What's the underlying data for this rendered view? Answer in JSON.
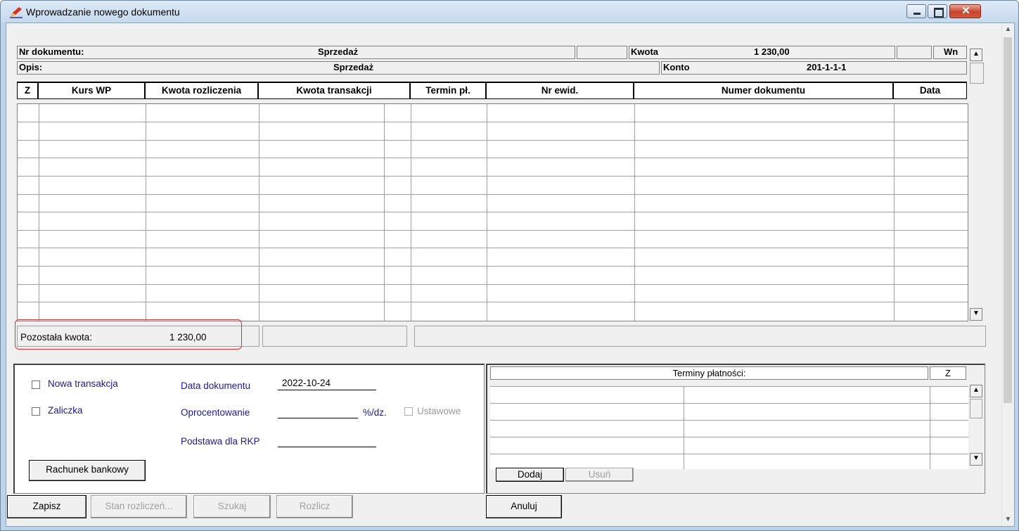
{
  "window": {
    "title": "Wprowadzanie nowego dokumentu",
    "icon": "pen-document-icon"
  },
  "header": {
    "nr_dokumentu_label": "Nr dokumentu:",
    "nr_dokumentu_value": "Sprzedaż",
    "kwota_label": "Kwota",
    "kwota_value": "1 230,00",
    "side": "Wn",
    "opis_label": "Opis:",
    "opis_value": "Sprzedaż",
    "konto_label": "Konto",
    "konto_value": "201-1-1-1"
  },
  "grid": {
    "columns": [
      "Z",
      "Kurs WP",
      "Kwota rozliczenia",
      "Kwota transakcji",
      "Termin pł.",
      "Nr ewid.",
      "Numer dokumentu",
      "Data"
    ],
    "rows": []
  },
  "status": {
    "remaining_label": "Pozostała kwota:",
    "remaining_value": "1 230,00"
  },
  "form": {
    "new_transaction": "Nowa transakcja",
    "advance": "Zaliczka",
    "doc_date_label": "Data dokumentu",
    "doc_date_value": "2022-10-24",
    "interest_label": "Oprocentowanie",
    "interest_unit": "%/dz.",
    "statutory": "Ustawowe",
    "rkp_label": "Podstawa dla RKP",
    "bank_account_button": "Rachunek bankowy"
  },
  "payments": {
    "title": "Terminy płatności:",
    "z_col": "Z",
    "add_button": "Dodaj",
    "remove_button": "Usuń"
  },
  "footer": {
    "save": "Zapisz",
    "settlement_state": "Stan rozliczeń...",
    "search": "Szukaj",
    "settle": "Rozlicz",
    "cancel": "Anuluj"
  }
}
